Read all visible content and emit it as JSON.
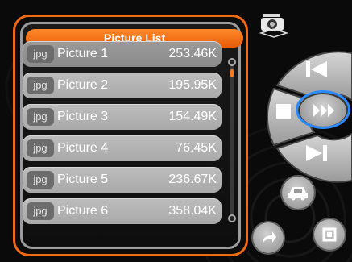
{
  "header": {
    "title": "Picture List"
  },
  "files": [
    {
      "type": "jpg",
      "name": "Picture 1",
      "size": "253.46K"
    },
    {
      "type": "jpg",
      "name": "Picture 2",
      "size": "195.95K"
    },
    {
      "type": "jpg",
      "name": "Picture 3",
      "size": "154.49K"
    },
    {
      "type": "jpg",
      "name": "Picture 4",
      "size": "76.45K"
    },
    {
      "type": "jpg",
      "name": "Picture 5",
      "size": "236.67K"
    },
    {
      "type": "jpg",
      "name": "Picture 6",
      "size": "358.04K"
    }
  ],
  "colors": {
    "accent": "#ee6a14",
    "highlight": "#2a8bff"
  },
  "icons": {
    "photo": "photo-stack-icon",
    "prev": "skip-previous-icon",
    "next": "skip-next-icon",
    "stop": "stop-icon",
    "play": "fast-forward-icon",
    "car": "car-icon",
    "back": "back-arrow-icon",
    "window": "window-icon"
  }
}
